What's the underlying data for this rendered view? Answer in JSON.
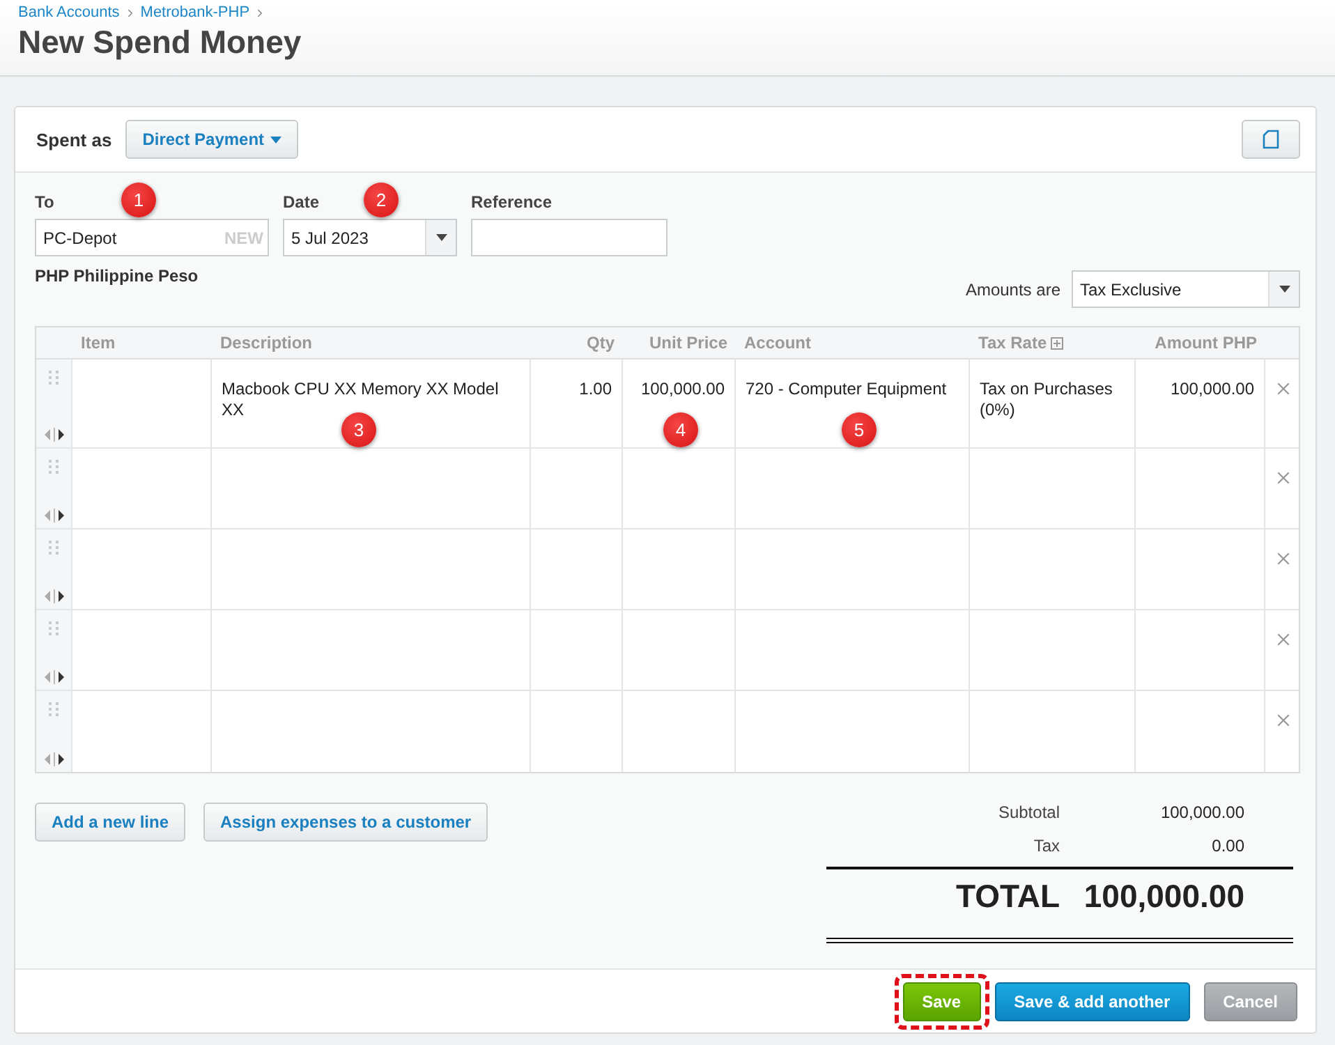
{
  "breadcrumb": [
    "Bank Accounts",
    "Metrobank-PHP"
  ],
  "title": "New Spend Money",
  "spent_as": {
    "label": "Spent as",
    "value": "Direct Payment"
  },
  "fields": [
    {
      "kind": "contact",
      "label": "To",
      "value": "PC-Depot",
      "suffix": "NEW",
      "callout": "1"
    },
    {
      "kind": "date",
      "label": "Date",
      "value": "5 Jul 2023",
      "callout": "2"
    },
    {
      "kind": "text",
      "label": "Reference"
    }
  ],
  "currency": "PHP Philippine Peso",
  "amounts_are": {
    "label": "Amounts are",
    "value": "Tax Exclusive"
  },
  "table": {
    "columns": [
      {
        "label": "Item",
        "expandable": false
      },
      {
        "label": "Description",
        "expandable": false
      },
      {
        "label": "Qty",
        "expandable": false
      },
      {
        "label": "Unit Price",
        "expandable": false
      },
      {
        "label": "Account",
        "expandable": false
      },
      {
        "label": "Tax Rate",
        "expandable": true
      },
      {
        "label": "Amount PHP",
        "expandable": false
      }
    ],
    "rows": [
      {
        "description": "Macbook CPU XX Memory XX Model XX",
        "qty": "1.00",
        "unit_price": "100,000.00",
        "account": "720 - Computer Equipment",
        "tax_rate": "Tax on Purchases (0%)",
        "amount": "100,000.00",
        "callouts": {
          "description": "3",
          "unit_price": "4",
          "account": "5"
        }
      },
      {},
      {},
      {},
      {}
    ]
  },
  "line_buttons": [
    "Add a new line",
    "Assign expenses to a customer"
  ],
  "totals": {
    "subtotal_label": "Subtotal",
    "subtotal": "100,000.00",
    "tax_label": "Tax",
    "tax": "0.00",
    "total_label": "TOTAL",
    "total": "100,000.00"
  },
  "actions": [
    {
      "kind": "primary",
      "label": "Save",
      "highlighted": true
    },
    {
      "kind": "secondary",
      "label": "Save & add another",
      "highlighted": false
    },
    {
      "kind": "cancel",
      "label": "Cancel",
      "highlighted": false
    }
  ]
}
